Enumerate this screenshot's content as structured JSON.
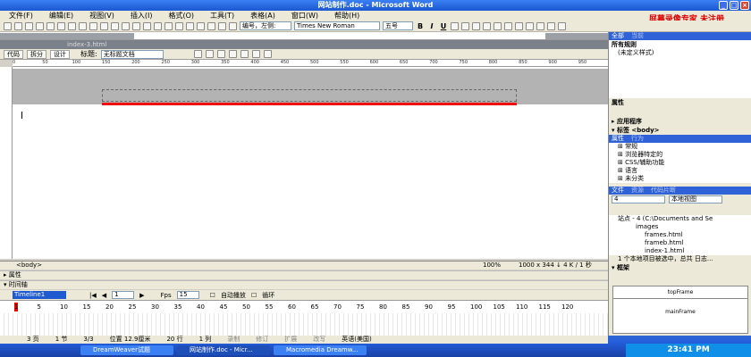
{
  "window": {
    "title": "网站制作.doc - Microsoft Word"
  },
  "watermark": "屏幕录像专家 未注册",
  "menu": [
    "文件(F)",
    "编辑(E)",
    "视图(V)",
    "插入(I)",
    "格式(O)",
    "工具(T)",
    "表格(A)",
    "窗口(W)",
    "帮助(H)"
  ],
  "toolbar": {
    "style": "编号，左侧:",
    "font": "Times New Roman",
    "size": "五号",
    "bold": "B",
    "italic": "I",
    "underline": "U"
  },
  "dw": {
    "tab": "index-3.html",
    "views": [
      "代码",
      "拆分",
      "设计"
    ],
    "title_label": "标题:",
    "title_value": "无标题文档",
    "ruler": [
      "0",
      "50",
      "100",
      "150",
      "200",
      "250",
      "300",
      "350",
      "400",
      "450",
      "500",
      "550",
      "600",
      "650",
      "700",
      "750",
      "800",
      "850",
      "900",
      "950"
    ],
    "status_tag": "<body>",
    "zoom": "100%",
    "size": "1000 x 344 ↓ 4 K / 1 秒",
    "props": "▸ 属性",
    "timeline_hdr": "▾ 时间轴",
    "timeline_select": "Timeline1",
    "timeline_frame": "1",
    "fps_label": "Fps",
    "fps_value": "15",
    "autoplay": "自动播放",
    "loop": "循环",
    "frames": [
      "1",
      "5",
      "10",
      "15",
      "20",
      "25",
      "30",
      "35",
      "40",
      "45",
      "50",
      "55",
      "60",
      "65",
      "70",
      "75",
      "80",
      "85",
      "90",
      "95",
      "100",
      "105",
      "110",
      "115",
      "120"
    ]
  },
  "right": {
    "tab1": "全部",
    "tab2": "当前",
    "all_rules": "所有规则",
    "undefined_style": "(未定义样式)",
    "attributes": "属性",
    "app": "▸ 应用程序",
    "tag_inspector": "▾ 标签 <body>",
    "attr_tabs": [
      "属性",
      "行为"
    ],
    "attr_items": [
      "⊞ 常规",
      "⊞ 浏览器特定的",
      "⊞ CSS/辅助功能",
      "⊞ 语言",
      "⊞ 未分类"
    ],
    "files_tabs": [
      "文件",
      "资源",
      "代码片断"
    ],
    "site_select": "4",
    "view_select": "本地视图",
    "site_root": "站点 - 4 (C:\\Documents and Se",
    "files": [
      "images",
      "frames.html",
      "frameb.html",
      "index-1.html"
    ],
    "file_status": "1 个本地项目被选中，总共",
    "log_btn": "日志...",
    "frame_hdr": "▾ 框架",
    "frame_top": "topFrame",
    "frame_main": "mainFrame"
  },
  "wordstatus": [
    "3 页",
    "1 节",
    "3/3",
    "位置 12.9厘米",
    "20 行",
    "1 列",
    "录制",
    "修订",
    "扩展",
    "改写",
    "英语(美国)"
  ],
  "taskbar": {
    "buttons": [
      "DreamWeaver试题",
      "网站制作.doc - Micr...",
      "Macromedia Dreamw..."
    ],
    "clock": "23:41 PM"
  },
  "colors": {
    "accent": "#245edb",
    "red_line": "#ee1010"
  }
}
